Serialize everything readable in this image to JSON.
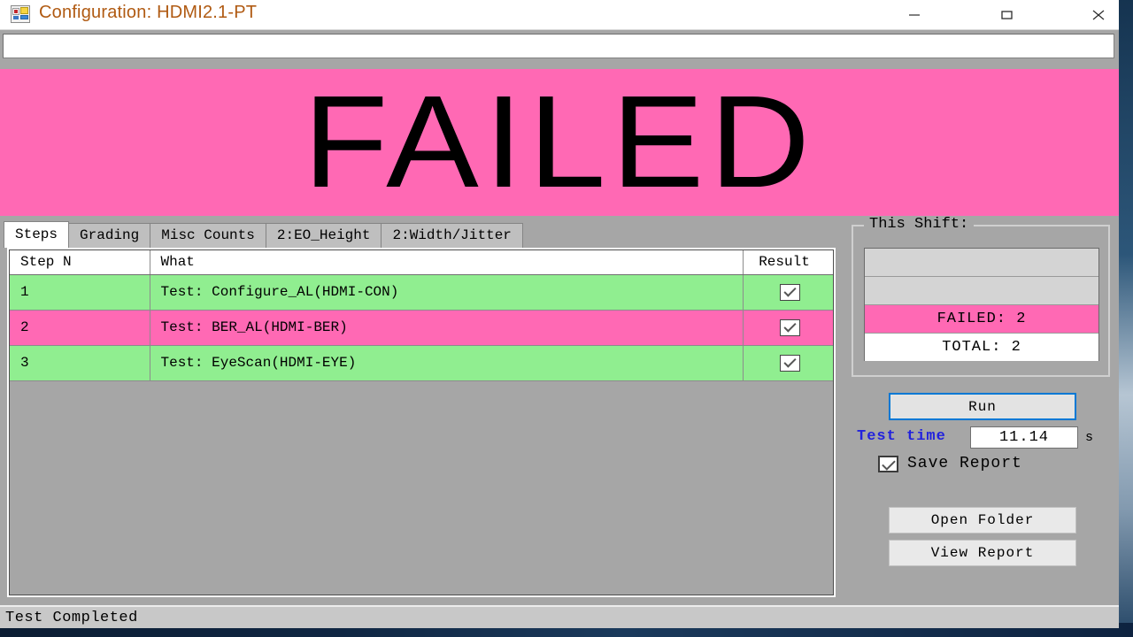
{
  "window": {
    "title": "Configuration: HDMI2.1-PT",
    "icon": "form-designer-icon",
    "controls": {
      "minimize": "—",
      "maximize": "▭",
      "close": "✕"
    }
  },
  "top_input": {
    "value": "",
    "placeholder": ""
  },
  "verdict": {
    "text": "FAILED",
    "background": "#ff69b4",
    "foreground": "#000000"
  },
  "tabs": [
    {
      "label": "Steps",
      "active": true
    },
    {
      "label": "Grading",
      "active": false
    },
    {
      "label": "Misc Counts",
      "active": false
    },
    {
      "label": "2:EO_Height",
      "active": false
    },
    {
      "label": "2:Width/Jitter",
      "active": false
    }
  ],
  "grid": {
    "columns": [
      "Step N",
      "What",
      "Result"
    ],
    "rows": [
      {
        "step": "1",
        "what": "Test: Configure_AL(HDMI-CON)",
        "result": "checked",
        "status": "pass",
        "selected": true
      },
      {
        "step": "2",
        "what": "Test: BER_AL(HDMI-BER)",
        "result": "checked",
        "status": "fail",
        "selected": false
      },
      {
        "step": "3",
        "what": "Test: EyeScan(HDMI-EYE)",
        "result": "checked",
        "status": "pass",
        "selected": false
      }
    ]
  },
  "shift_panel": {
    "legend": "This Shift:",
    "rows": [
      {
        "text": "",
        "kind": "blank"
      },
      {
        "text": "",
        "kind": "blank"
      },
      {
        "text": "FAILED: 2",
        "kind": "failed"
      },
      {
        "text": "TOTAL: 2",
        "kind": "total"
      }
    ]
  },
  "controls": {
    "run_label": "Run",
    "test_time_label": "Test time",
    "test_time_value": "11.14",
    "test_time_unit": "s",
    "save_report_label": "Save Report",
    "save_report_checked": "checked",
    "open_folder_label": "Open Folder",
    "view_report_label": "View Report"
  },
  "statusbar": {
    "text": "Test Completed"
  },
  "colors": {
    "pass": "#90ee90",
    "fail": "#ff69b4",
    "selection": "#0078d4",
    "accent_text": "#2222dd",
    "title_text": "#b05a12",
    "window_chrome": "#a6a6a6"
  }
}
